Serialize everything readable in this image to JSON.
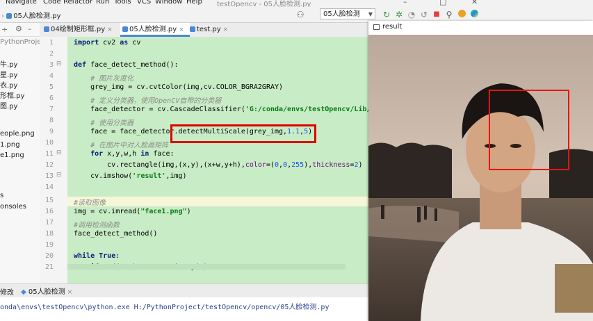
{
  "menubar": {
    "items": [
      "Navigate",
      "Code",
      "Refactor",
      "Run",
      "Tools",
      "VCS",
      "Window",
      "Help"
    ],
    "title": "testOpencv - 05人脸检测.py"
  },
  "navbar": {
    "breadcrumb": "05人脸检测.py",
    "run_config": "05人脸检测"
  },
  "project_panel": {
    "root_label": "PythonProject",
    "items": [
      "牛.py",
      "星.py",
      "衣.py",
      "形框.py",
      "图.py",
      "",
      "eople.png",
      "1.png",
      "e1.png",
      "",
      "",
      "",
      "",
      "s",
      "onsoles"
    ]
  },
  "editor": {
    "tabs": [
      {
        "label": "04绘制矩形框.py",
        "active": false
      },
      {
        "label": "05人脸检测.py",
        "active": true
      },
      {
        "label": "test.py",
        "active": false
      }
    ],
    "line_numbers": [
      "1",
      "2",
      "3",
      "4",
      "5",
      "6",
      "7",
      "8",
      "9",
      "10",
      "11",
      "12",
      "13",
      "14",
      "15",
      "16",
      "17",
      "18",
      "19",
      "20",
      "21"
    ],
    "code": {
      "l1_kw": "import",
      "l1_rest": " cv2 ",
      "l1_as": "as",
      "l1_end": " cv",
      "l3_kw": "def",
      "l3_rest": " face_detect_method():",
      "l4": "    # 图片灰度化",
      "l5": "    grey_img = cv.cvtColor(img,cv.COLOR_BGRA2GRAY)",
      "l6": "    # 定义分类器，使用OpenCV自带的分类器",
      "l7_a": "    face_detector = cv.CascadeClassifier(",
      "l7_str": "'G:/conda/envs/testOpencv/Lib/s",
      "l8": "    # 使用分类器",
      "l9_a": "    face = face_detector.detectMultiScale(grey_img,",
      "l9_n1": "1.1",
      "l9_c": ",",
      "l9_n2": "5",
      "l9_end": ")",
      "l10": "    # 在图片中对人脸画矩阵",
      "l11_a": "    ",
      "l11_for": "for",
      "l11_b": " x,y,w,h ",
      "l11_in": "in",
      "l11_c": " face:",
      "l12_a": "        cv.rectangle(img,(x,y),(x+w,y+h),",
      "l12_p1": "color",
      "l12_b": "=(",
      "l12_n1": "0",
      "l12_c1": ",",
      "l12_n2": "0",
      "l12_c2": ",",
      "l12_n3": "255",
      "l12_d": "),",
      "l12_p2": "thickness",
      "l12_e": "=",
      "l12_n4": "2",
      "l12_f": ")",
      "l13_a": "    cv.imshow(",
      "l13_str": "'result'",
      "l13_b": ",img)",
      "l15": "#读取图像",
      "l16_a": "img = cv.imread(",
      "l16_str": "\"face1.png\"",
      "l16_b": ")",
      "l17": "#调用检测函数",
      "l18": "face_detect_method()",
      "l20_kw": "while",
      "l20_t": " True",
      "l20_b": ":",
      "l21_a": "    ",
      "l21_if": "if",
      "l21_b": " ord(",
      "l21_str": "'m'",
      "l21_c": ") == cv.waitKey(",
      "l21_n": "0",
      "l21_d": "):"
    }
  },
  "run_panel": {
    "tabs": [
      "修改",
      "05人脸检测"
    ],
    "output": "onda\\envs\\testOpencv\\python.exe H:/PythonProject/testOpencv/opencv/05人脸检测.py"
  },
  "result_window": {
    "title": "result"
  }
}
